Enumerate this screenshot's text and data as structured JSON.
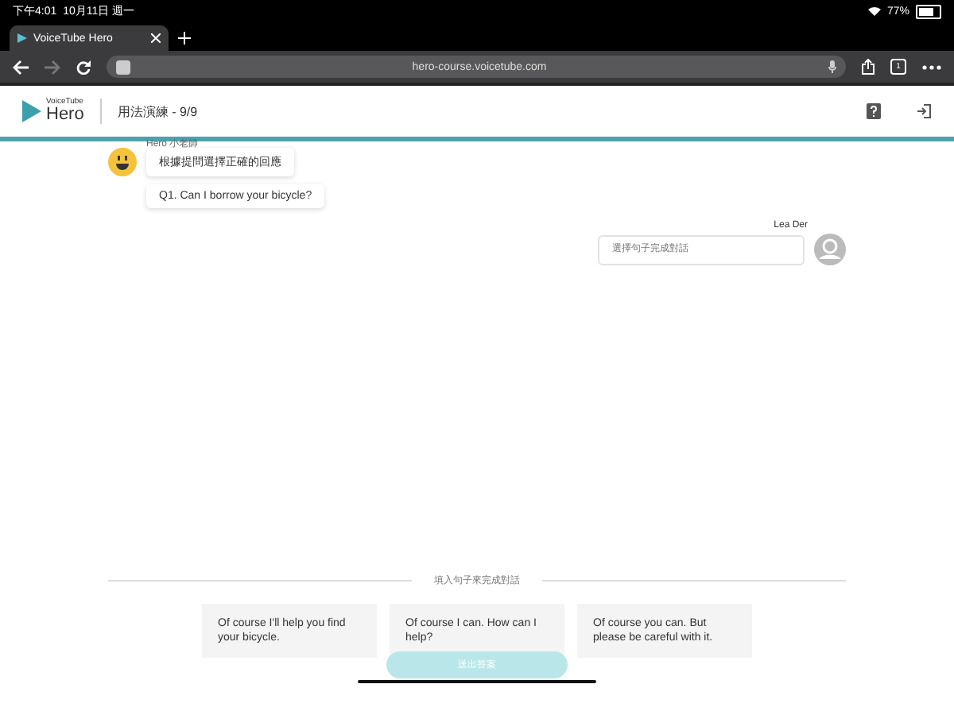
{
  "status_bar": {
    "time": "下午4:01",
    "date": "10月11日 週一",
    "battery": "77%"
  },
  "browser": {
    "tab_title": "VoiceTube Hero",
    "url": "hero-course.voicetube.com",
    "tab_count": "1"
  },
  "header": {
    "logo_small": "VoiceTube",
    "logo": "Hero",
    "title": "用法演練 - 9/9"
  },
  "chat": {
    "bot_name": "Hero 小老師",
    "bot_messages": [
      "根據提問選擇正確的回應",
      "Q1. Can I borrow your bicycle?"
    ],
    "user_name": "Lea Der",
    "answer": {
      "placeholder": "選擇句子完成對話"
    }
  },
  "divider_label": "填入句子來完成對話",
  "options": [
    {
      "text": "Of course I'll help you find your bicycle.",
      "selected": false
    },
    {
      "text": "Of course I can. How can I help?",
      "selected": false
    },
    {
      "text": "Of course you can. But please be careful with it.",
      "selected": false
    }
  ],
  "submit": {
    "label": "送出答案",
    "disabled": true
  }
}
